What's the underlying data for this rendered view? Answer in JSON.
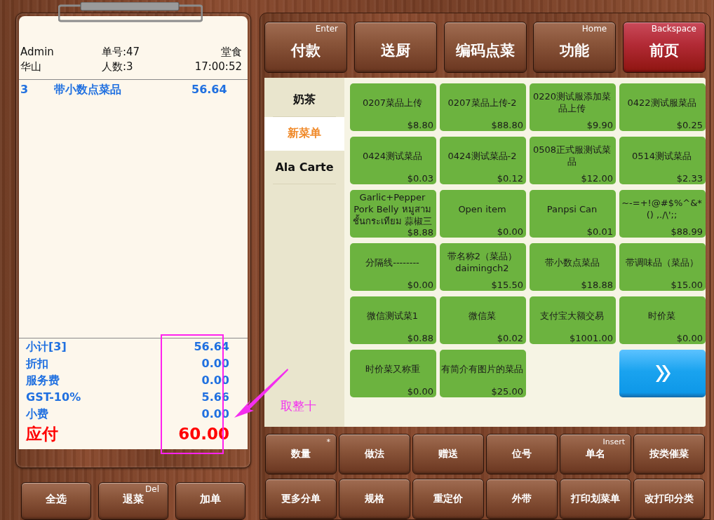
{
  "order": {
    "header": [
      {
        "label": "Admin"
      },
      {
        "label": "单号:47"
      },
      {
        "label": "堂食"
      },
      {
        "label": "华山"
      },
      {
        "label": "人数:3"
      },
      {
        "label": "17:00:52"
      }
    ],
    "items": [
      {
        "qty": "3",
        "name": "带小数点菜品",
        "amount": "56.64"
      }
    ],
    "totals": [
      {
        "label": "小计[3]",
        "value": "56.64",
        "kind": "normal"
      },
      {
        "label": "折扣",
        "value": "0.00",
        "kind": "normal"
      },
      {
        "label": "服务费",
        "value": "0.00",
        "kind": "normal"
      },
      {
        "label": "GST-10%",
        "value": "5.66",
        "kind": "normal"
      },
      {
        "label": "小费",
        "value": "0.00",
        "kind": "normal"
      },
      {
        "label": "应付",
        "value": "60.00",
        "kind": "due"
      }
    ]
  },
  "annotation": {
    "note": "取整十"
  },
  "left_buttons": [
    {
      "label": "全选"
    },
    {
      "label": "退菜",
      "shortcut": "Del"
    },
    {
      "label": "加单"
    }
  ],
  "top_buttons": [
    {
      "label": "付款",
      "shortcut": "Enter",
      "kind": "normal"
    },
    {
      "label": "送厨",
      "kind": "normal"
    },
    {
      "label": "编码点菜",
      "kind": "normal"
    },
    {
      "label": "功能",
      "shortcut": "Home",
      "kind": "normal"
    },
    {
      "label": "前页",
      "shortcut": "Backspace",
      "kind": "danger"
    }
  ],
  "categories": [
    {
      "label": "奶茶",
      "selected": false
    },
    {
      "label": "新菜单",
      "selected": true
    },
    {
      "label": "Ala Carte",
      "selected": false
    }
  ],
  "dishes": [
    {
      "name": "0207菜品上传",
      "price": "$8.80"
    },
    {
      "name": "0207菜品上传-2",
      "price": "$88.80"
    },
    {
      "name": "0220测试服添加菜品上传",
      "price": "$9.90"
    },
    {
      "name": "0422测试服菜品",
      "price": "$0.25"
    },
    {
      "name": "0424测试菜品",
      "price": "$0.03"
    },
    {
      "name": "0424测试菜品-2",
      "price": "$0.12"
    },
    {
      "name": "0508正式服测试菜品",
      "price": "$12.00"
    },
    {
      "name": "0514测试菜品",
      "price": "$2.33"
    },
    {
      "name": "Garlic+Pepper Pork Belly หมูสาม ชั้นกระเทียม 蒜椒三",
      "price": "$8.88"
    },
    {
      "name": "Open item",
      "price": "$0.00"
    },
    {
      "name": "Panpsi Can",
      "price": "$0.01"
    },
    {
      "name": "~-=+!@#$%^&*() ,./\\';;",
      "price": "$88.99"
    },
    {
      "name": "分隔线--------",
      "price": "$0.00"
    },
    {
      "name": "带名称2（菜品） daimingch2",
      "price": "$15.50"
    },
    {
      "name": "带小数点菜品",
      "price": "$18.88"
    },
    {
      "name": "带调味品（菜品）",
      "price": "$15.00"
    },
    {
      "name": "微信测试菜1",
      "price": "$0.88"
    },
    {
      "name": "微信菜",
      "price": "$0.02"
    },
    {
      "name": "支付宝大额交易",
      "price": "$1001.00"
    },
    {
      "name": "时价菜",
      "price": "$0.00"
    },
    {
      "name": "时价菜又称重",
      "price": "$0.00"
    },
    {
      "name": "有简介有图片的菜品",
      "price": "$25.00"
    }
  ],
  "bottom_buttons": [
    {
      "label": "数量",
      "shortcut": "*"
    },
    {
      "label": "做法"
    },
    {
      "label": "赠送"
    },
    {
      "label": "位号"
    },
    {
      "label": "单名",
      "shortcut": "Insert"
    },
    {
      "label": "按类催菜"
    },
    {
      "label": "更多分单"
    },
    {
      "label": "规格"
    },
    {
      "label": "重定价"
    },
    {
      "label": "外带"
    },
    {
      "label": "打印划菜单"
    },
    {
      "label": "改打印分类"
    }
  ]
}
